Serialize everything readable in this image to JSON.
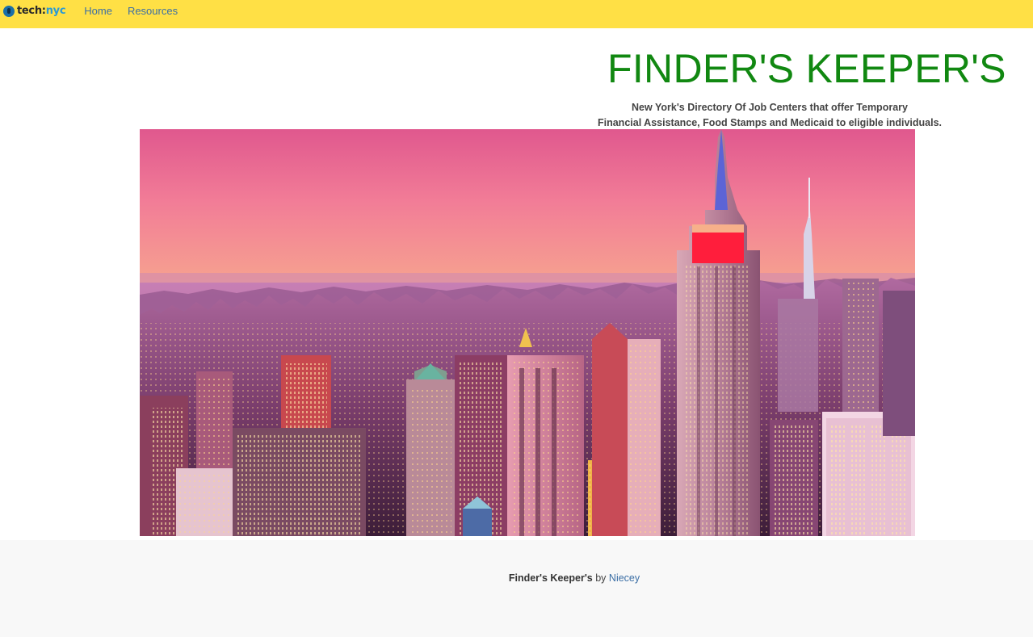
{
  "header": {
    "brand_part1": "tech:",
    "brand_part2": "nyc",
    "nav": [
      "Home",
      "Resources"
    ]
  },
  "main": {
    "title": "FINDER'S KEEPER'S",
    "subtitle_line1": "New York's Directory Of Job Centers that offer Temporary",
    "subtitle_line2": "Financial Assistance, Food Stamps and Medicaid to eligible individuals."
  },
  "footer": {
    "site_name": "Finder's Keeper's",
    "by": "by",
    "author": "Niecey"
  },
  "colors": {
    "navbar": "#ffe045",
    "title": "#118811",
    "link": "#3b6ea5",
    "footer_bg": "#f8f8f8"
  }
}
